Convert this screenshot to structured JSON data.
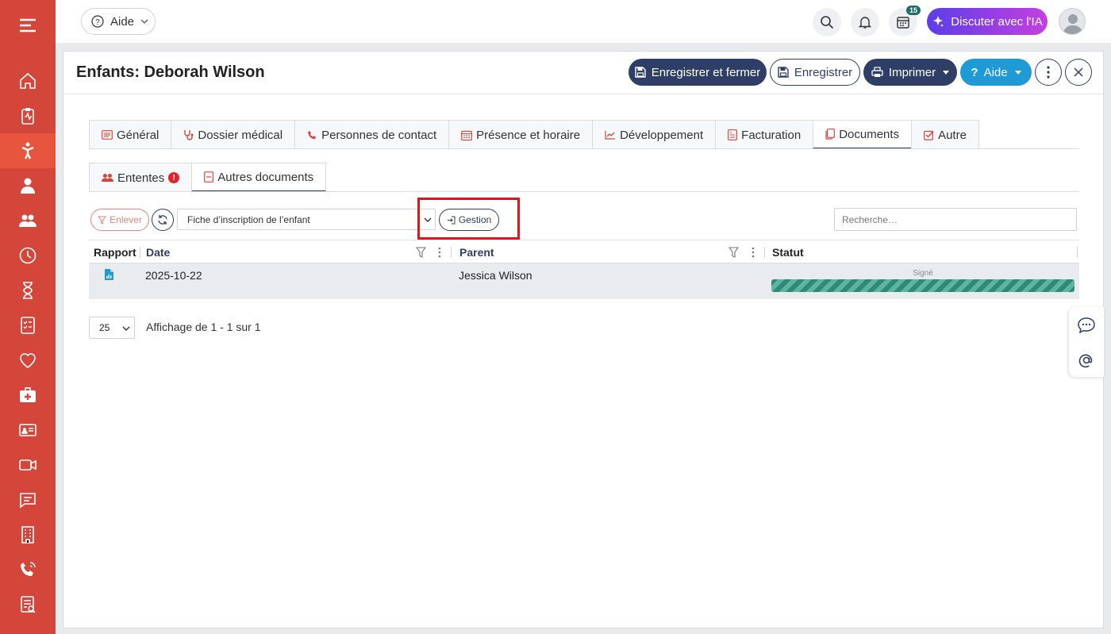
{
  "colors": {
    "sidebar": "#d4463a",
    "primary": "#2f3e66",
    "help_blue": "#1e9ad6",
    "ai_gradient_start": "#5b3ee8",
    "ai_gradient_end": "#c53fe0",
    "status_green": "#2d8a76",
    "highlight_red": "#e0141b"
  },
  "sidebar": {
    "items": [
      {
        "icon": "home-icon"
      },
      {
        "icon": "clipboard-pulse-icon"
      },
      {
        "icon": "child-icon",
        "active": true
      },
      {
        "icon": "staff-icon"
      },
      {
        "icon": "group-icon"
      },
      {
        "icon": "clock-icon"
      },
      {
        "icon": "hourglass-icon"
      },
      {
        "icon": "checklist-icon"
      },
      {
        "icon": "heart-icon"
      },
      {
        "icon": "medical-kit-icon"
      },
      {
        "icon": "id-card-icon"
      },
      {
        "icon": "video-icon"
      },
      {
        "icon": "message-icon"
      },
      {
        "icon": "building-icon"
      },
      {
        "icon": "phone-icon"
      },
      {
        "icon": "report-icon"
      }
    ]
  },
  "topbar": {
    "help_label": "Aide",
    "calendar_badge": "15",
    "ai_label": "Discuter avec l'IA"
  },
  "modal": {
    "title": "Enfants: Deborah Wilson",
    "save_close_label": "Enregistrer et fermer",
    "save_label": "Enregistrer",
    "print_label": "Imprimer",
    "help_label": "Aide"
  },
  "tabs": [
    {
      "label": "Général",
      "icon": "document-list-icon"
    },
    {
      "label": "Dossier médical",
      "icon": "stethoscope-icon"
    },
    {
      "label": "Personnes de contact",
      "icon": "phone-icon"
    },
    {
      "label": "Présence et horaire",
      "icon": "calendar-icon"
    },
    {
      "label": "Développement",
      "icon": "chart-line-icon"
    },
    {
      "label": "Facturation",
      "icon": "invoice-icon"
    },
    {
      "label": "Documents",
      "icon": "documents-icon",
      "active": true
    },
    {
      "label": "Autre",
      "icon": "checkbox-icon"
    }
  ],
  "subtabs": [
    {
      "label": "Ententes",
      "icon": "group-icon",
      "alert": "!"
    },
    {
      "label": "Autres documents",
      "icon": "file-icon",
      "active": true
    }
  ],
  "toolbar": {
    "remove_label": "Enlever",
    "document_type": "Fiche d’inscription de l’enfant",
    "manage_label": "Gestion",
    "search_placeholder": "Recherche…"
  },
  "grid": {
    "columns": [
      "Rapport",
      "Date",
      "Parent",
      "Statut"
    ],
    "rows": [
      {
        "report_icon": "file-chart-icon",
        "date": "2025-10-22",
        "parent": "Jessica Wilson",
        "status": "Signé",
        "progress": 1.0
      }
    ]
  },
  "pager": {
    "page_size": "25",
    "info": "Affichage de 1 - 1 sur 1"
  }
}
